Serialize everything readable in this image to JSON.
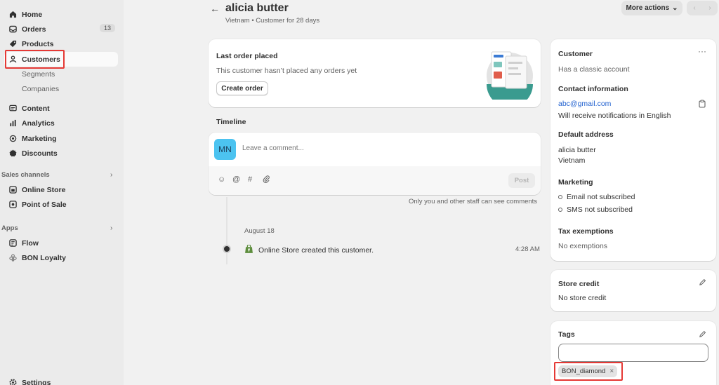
{
  "sidebar": {
    "items": [
      {
        "label": "Home",
        "icon": "home-icon"
      },
      {
        "label": "Orders",
        "icon": "inbox-icon",
        "badge": "13"
      },
      {
        "label": "Products",
        "icon": "tag-icon"
      },
      {
        "label": "Customers",
        "icon": "person-icon",
        "active": true
      },
      {
        "label": "Content",
        "icon": "content-icon"
      },
      {
        "label": "Analytics",
        "icon": "chart-bar-icon"
      },
      {
        "label": "Marketing",
        "icon": "target-icon"
      },
      {
        "label": "Discounts",
        "icon": "discount-icon"
      }
    ],
    "customer_subitems": [
      "Segments",
      "Companies"
    ],
    "sales_channels": {
      "label": "Sales channels",
      "items": [
        {
          "label": "Online Store",
          "icon": "store-icon"
        },
        {
          "label": "Point of Sale",
          "icon": "pos-icon"
        }
      ]
    },
    "apps": {
      "label": "Apps",
      "items": [
        {
          "label": "Flow",
          "icon": "flow-icon"
        },
        {
          "label": "BON Loyalty",
          "icon": "loyalty-icon"
        }
      ]
    },
    "settings_label": "Settings"
  },
  "header": {
    "title": "alicia butter",
    "subtitle": "Vietnam • Customer for 28 days",
    "more_actions": "More actions"
  },
  "last_order": {
    "title": "Last order placed",
    "text": "This customer hasn’t placed any orders yet",
    "button": "Create order"
  },
  "timeline": {
    "title": "Timeline",
    "avatar_initials": "MN",
    "comment_placeholder": "Leave a comment...",
    "post_label": "Post",
    "staff_note": "Only you and other staff can see comments",
    "date": "August 18",
    "event": "Online Store created this customer.",
    "time": "4:28 AM"
  },
  "customer_card": {
    "title": "Customer",
    "account_type": "Has a classic account",
    "contact_title": "Contact information",
    "email": "abc@gmail.com",
    "notification_lang": "Will receive notifications in English",
    "address_title": "Default address",
    "address_lines": [
      "alicia butter",
      "Vietnam"
    ],
    "marketing_title": "Marketing",
    "marketing_items": [
      "Email not subscribed",
      "SMS not subscribed"
    ],
    "tax_title": "Tax exemptions",
    "tax_value": "No exemptions"
  },
  "store_credit": {
    "title": "Store credit",
    "value": "No store credit"
  },
  "tags": {
    "title": "Tags",
    "input_value": "",
    "items": [
      "BON_diamond"
    ]
  },
  "colors": {
    "highlight": "#e53935",
    "link": "#2463d0",
    "avatar": "#4cc3f0"
  }
}
